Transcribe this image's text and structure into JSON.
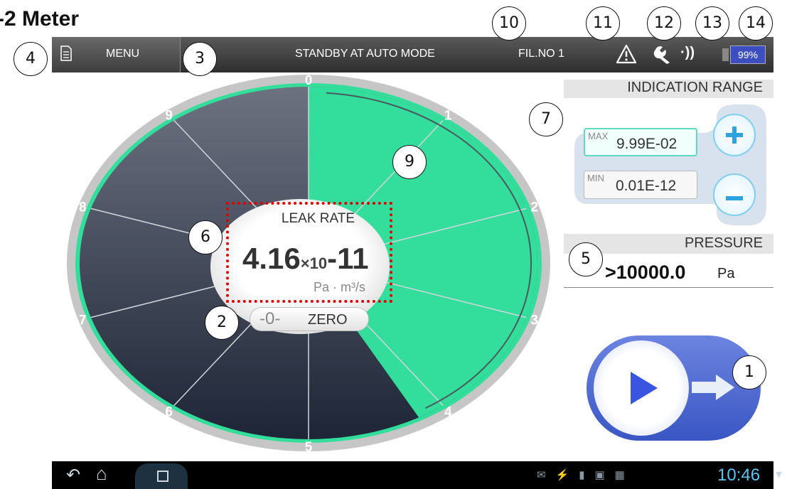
{
  "heading": "-2 Meter",
  "appbar": {
    "menu_label": "MENU",
    "status": "STANDBY AT AUTO MODE",
    "filament": "FIL.NO 1",
    "battery": "99%"
  },
  "indication_range": {
    "title": "INDICATION RANGE",
    "max_tag": "MAX",
    "max_value": "9.99E-02",
    "min_tag": "MIN",
    "min_value": "0.01E-12"
  },
  "pressure": {
    "title": "PRESSURE",
    "value": ">10000.0",
    "unit": "Pa"
  },
  "leak_rate": {
    "title": "LEAK RATE",
    "mantissa": "4.16",
    "mid": "×10",
    "exponent": "-11",
    "unit": "Pa · m³/s"
  },
  "zero": {
    "symbol": "-0-",
    "label": "ZERO"
  },
  "dial": {
    "tick_labels": [
      "0",
      "1",
      "2",
      "3",
      "4",
      "5",
      "6",
      "7",
      "8",
      "9"
    ],
    "fill_level_fraction": 0.42,
    "colors": {
      "fill": "#33dd9c",
      "dark": "#2d3545",
      "ring": "#c0c0c0"
    }
  },
  "callouts": [
    "1",
    "2",
    "3",
    "4",
    "5",
    "6",
    "7",
    "9",
    "10",
    "11",
    "12",
    "13",
    "14"
  ],
  "navbar": {
    "clock": "10:46"
  }
}
